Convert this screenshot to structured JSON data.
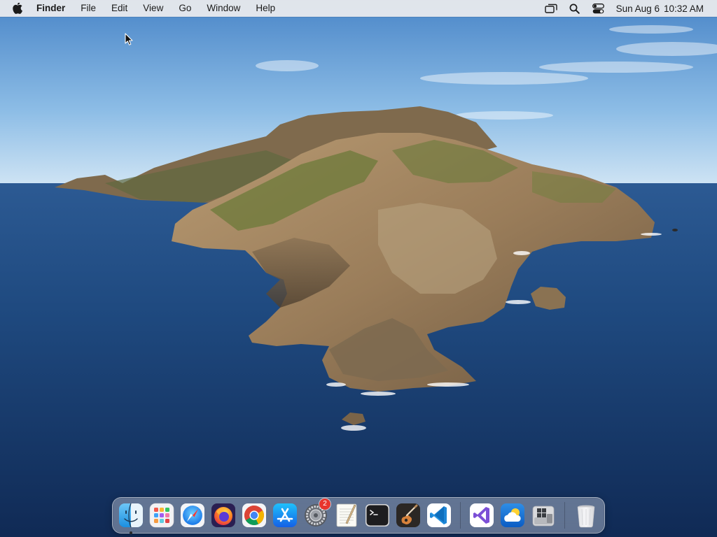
{
  "menubar": {
    "app_name": "Finder",
    "menus": [
      "File",
      "Edit",
      "View",
      "Go",
      "Window",
      "Help"
    ],
    "status_icons": [
      "screen-mirroring-icon",
      "spotlight-search-icon",
      "control-center-icon"
    ],
    "date": "Sun Aug 6",
    "time": "10:32 AM"
  },
  "desktop": {
    "wallpaper": "island-ocean-wallpaper"
  },
  "dock": {
    "apps": [
      {
        "name": "Finder",
        "icon": "finder-icon",
        "running": true
      },
      {
        "name": "Launchpad",
        "icon": "launchpad-icon"
      },
      {
        "name": "Safari",
        "icon": "safari-icon"
      },
      {
        "name": "Firefox",
        "icon": "firefox-icon"
      },
      {
        "name": "Google Chrome",
        "icon": "chrome-icon"
      },
      {
        "name": "App Store",
        "icon": "app-store-icon"
      },
      {
        "name": "System Preferences",
        "icon": "system-preferences-icon",
        "badge": "2"
      },
      {
        "name": "TextEdit",
        "icon": "textedit-icon"
      },
      {
        "name": "Terminal",
        "icon": "terminal-icon"
      },
      {
        "name": "Instruments",
        "icon": "instruments-icon"
      },
      {
        "name": "Visual Studio Code",
        "icon": "vscode-icon"
      }
    ],
    "others": [
      {
        "name": "Visual Studio",
        "icon": "visual-studio-icon"
      },
      {
        "name": "Weather",
        "icon": "weather-icon"
      },
      {
        "name": "Boot Camp Assistant",
        "icon": "bootcamp-icon"
      }
    ],
    "trash": {
      "name": "Trash",
      "icon": "trash-icon"
    }
  },
  "colors": {
    "sky_top": "#4a86c8",
    "sea": "#1a3f70",
    "menubar_bg": "#ececee",
    "badge_red": "#e8352d"
  }
}
